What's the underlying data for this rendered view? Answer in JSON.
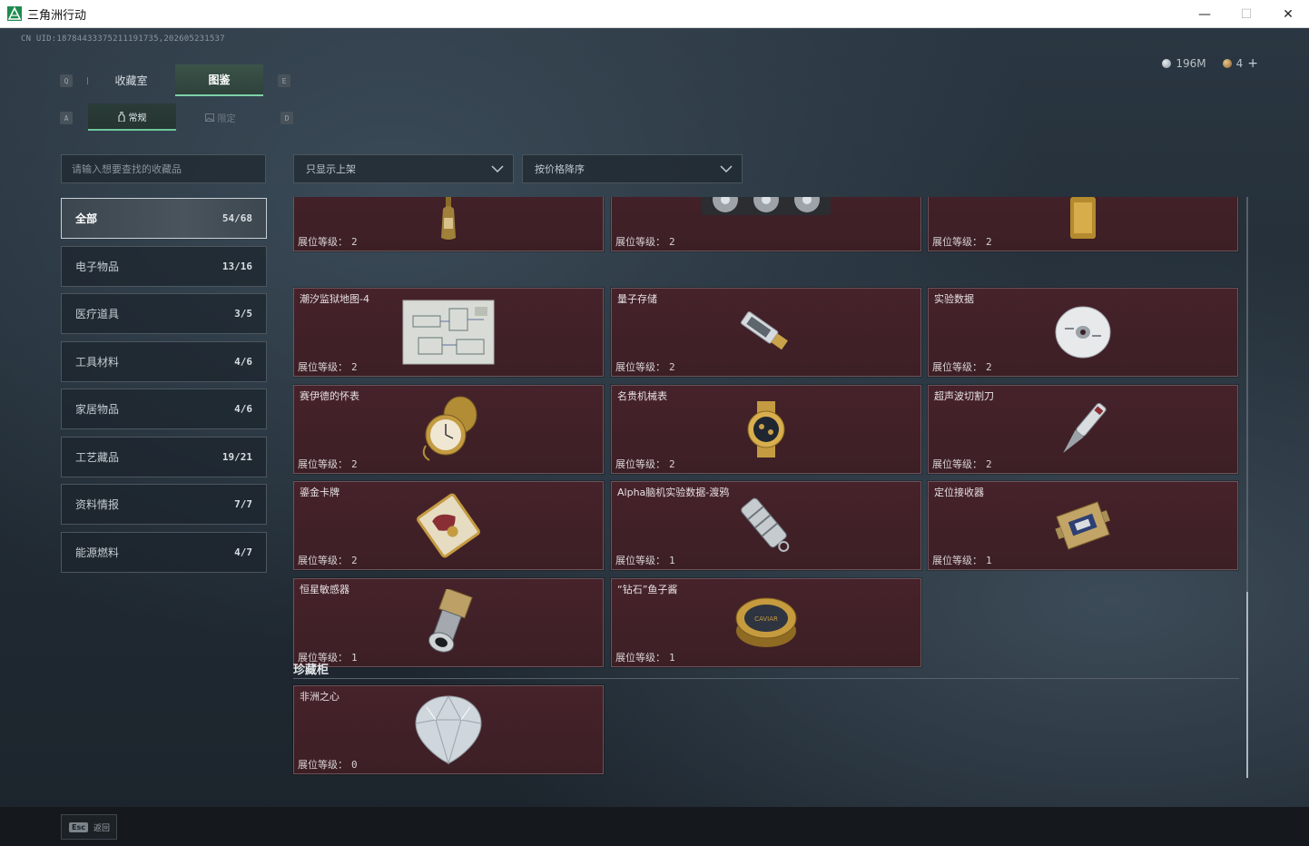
{
  "window": {
    "title": "三角洲行动",
    "minimize": "—",
    "maximize": "☐",
    "close": "✕"
  },
  "header": {
    "uid": "CN UID:18784433375211191735,202605231537",
    "currency": [
      {
        "icon": "silver-coin-icon",
        "value": "196M"
      },
      {
        "icon": "bronze-coin-icon",
        "value": "4"
      }
    ],
    "plus": "+"
  },
  "keys": {
    "tab_left": "Q",
    "tab_right": "E",
    "sub_left": "A",
    "sub_right": "D"
  },
  "tabs": [
    {
      "label": "收藏室",
      "active": false
    },
    {
      "label": "图鉴",
      "active": true
    }
  ],
  "subtabs": [
    {
      "label": "常规",
      "icon": "bottle-icon",
      "active": true
    },
    {
      "label": "限定",
      "icon": "image-icon",
      "active": false
    }
  ],
  "search": {
    "placeholder": "请输入想要查找的收藏品",
    "value": ""
  },
  "categories": [
    {
      "label": "全部",
      "count": "54/68",
      "active": true
    },
    {
      "label": "电子物品",
      "count": "13/16"
    },
    {
      "label": "医疗道具",
      "count": "3/5"
    },
    {
      "label": "工具材料",
      "count": "4/6"
    },
    {
      "label": "家居物品",
      "count": "4/6"
    },
    {
      "label": "工艺藏品",
      "count": "19/21"
    },
    {
      "label": "资料情报",
      "count": "7/7"
    },
    {
      "label": "能源燃料",
      "count": "4/7"
    }
  ],
  "filters": {
    "display": "只显示上架",
    "sort": "按价格降序"
  },
  "level_label": "展位等级：",
  "items": [
    {
      "name": "",
      "level": "2",
      "icon": "bottle-icon"
    },
    {
      "name": "",
      "level": "2",
      "icon": "graphics-card-icon"
    },
    {
      "name": "",
      "level": "2",
      "icon": "gold-bar-icon"
    },
    {
      "name": "潮汐监狱地图-4",
      "level": "2",
      "icon": "map-icon"
    },
    {
      "name": "量子存储",
      "level": "2",
      "icon": "usb-drive-icon"
    },
    {
      "name": "实验数据",
      "level": "2",
      "icon": "disc-icon"
    },
    {
      "name": "赛伊德的怀表",
      "level": "2",
      "icon": "pocket-watch-icon"
    },
    {
      "name": "名贵机械表",
      "level": "2",
      "icon": "wristwatch-icon"
    },
    {
      "name": "超声波切割刀",
      "level": "2",
      "icon": "ultrasonic-knife-icon"
    },
    {
      "name": "鎏金卡牌",
      "level": "2",
      "icon": "gold-card-icon"
    },
    {
      "name": "Alpha脑机实验数据-渡鸦",
      "level": "1",
      "icon": "data-canister-icon"
    },
    {
      "name": "定位接收器",
      "level": "1",
      "icon": "receiver-icon"
    },
    {
      "name": "恒星敏感器",
      "level": "1",
      "icon": "star-sensor-icon"
    },
    {
      "name": "“钻石”鱼子酱",
      "level": "1",
      "icon": "caviar-tin-icon"
    }
  ],
  "section": {
    "title": "珍藏柜",
    "items": [
      {
        "name": "非洲之心",
        "level": "0",
        "icon": "diamond-icon"
      }
    ]
  },
  "caviar_label": "CAVIAR",
  "footer": {
    "esc_key": "Esc",
    "esc_label": "返回"
  }
}
